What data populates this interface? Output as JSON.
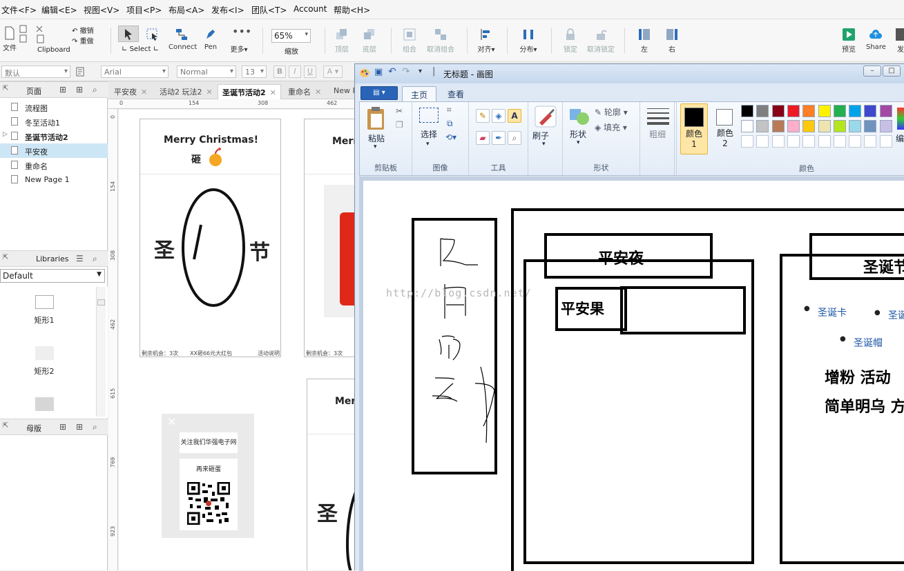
{
  "menubar": {
    "items": [
      "文件<F>",
      "编辑<E>",
      "视图<V>",
      "项目<P>",
      "布局<A>",
      "发布<I>",
      "团队<T>",
      "Account",
      "帮助<H>"
    ]
  },
  "toolbar": {
    "file": "文件",
    "undo": "撤销",
    "redo": "重做",
    "clipboard": "Clipboard",
    "select": "Select",
    "connect": "Connect",
    "pen": "Pen",
    "more": "更多▾",
    "zoom_value": "65%",
    "zoom_label": "缩放",
    "top": "顶层",
    "bottom": "底层",
    "group": "组合",
    "ungroup": "取消组合",
    "align": "对齐▾",
    "distribute": "分布▾",
    "lock": "锁定",
    "unlock": "取消锁定",
    "left": "左",
    "right": "右",
    "preview": "预览",
    "share": "Share",
    "publish": "发"
  },
  "format": {
    "style": "默认",
    "font": "Arial",
    "weight": "Normal",
    "size": "13",
    "bold": "B",
    "italic": "I",
    "underline": "U",
    "color_a": "A"
  },
  "pages_panel": {
    "title": "页面",
    "items": [
      "流程图",
      "冬至活动1",
      "圣诞节活动2",
      "平安夜",
      "重命名",
      "New Page 1"
    ]
  },
  "libraries_panel": {
    "title": "Libraries",
    "dropdown": "Default",
    "items": [
      "矩形1",
      "矩形2"
    ]
  },
  "masters_panel": {
    "title": "母版"
  },
  "tabs": [
    {
      "label": "平安夜"
    },
    {
      "label": "活动2 玩法2"
    },
    {
      "label": "圣诞节活动2"
    },
    {
      "label": "重命名"
    },
    {
      "label": "New P"
    }
  ],
  "ruler": {
    "h": [
      "0",
      "154",
      "308",
      "462"
    ],
    "v": [
      "0",
      "154",
      "308",
      "462",
      "615",
      "769",
      "923"
    ]
  },
  "canvas": {
    "card1_title": "Merry Christmas!",
    "card1_sub": "砸",
    "left_char": "圣",
    "right_char": "节",
    "footer_left": "剩余机会：3次",
    "footer_mid": "XX砸66元大红包",
    "footer_right": "活动说明",
    "card2_title": "Merr",
    "card2_footer": "剩余机会：3次",
    "popup_follow": "关注我们华强电子网",
    "popup_again": "再来砸蛋",
    "card3_title": "Mer",
    "card3_char": "圣"
  },
  "paint": {
    "title": "无标题 - 画图",
    "tab_home": "主页",
    "tab_view": "查看",
    "paste": "粘贴",
    "clipboard": "剪贴板",
    "select": "选择",
    "image": "图像",
    "tools": "工具",
    "brush": "刷子",
    "shape": "形状",
    "outline": "轮廓",
    "fill": "填充",
    "shapes": "形状",
    "thickness": "粗细",
    "color1": "颜色 1",
    "color2": "颜色 2",
    "edit_colors": "编辑",
    "colors": "颜色",
    "palette_row1": [
      "#000000",
      "#7f7f7f",
      "#880015",
      "#ed1c24",
      "#ff7f27",
      "#fff200",
      "#22b14c",
      "#00a2e8",
      "#3f48cc",
      "#a349a4"
    ],
    "palette_row2": [
      "#ffffff",
      "#c3c3c3",
      "#b97a57",
      "#ffaec9",
      "#ffc90e",
      "#efe4b0",
      "#b5e61d",
      "#99d9ea",
      "#7092be",
      "#c8bfe7"
    ]
  },
  "drawing": {
    "title_left": "平安夜",
    "label_apple": "平安果",
    "title_right": "圣诞节",
    "bullet1": "圣诞卡",
    "bullet2": "圣诞",
    "bullet3": "圣诞帽",
    "line1": "增粉  活动",
    "line2": "简单明乌 方",
    "watermark": "http://blog.csdn.net/"
  }
}
